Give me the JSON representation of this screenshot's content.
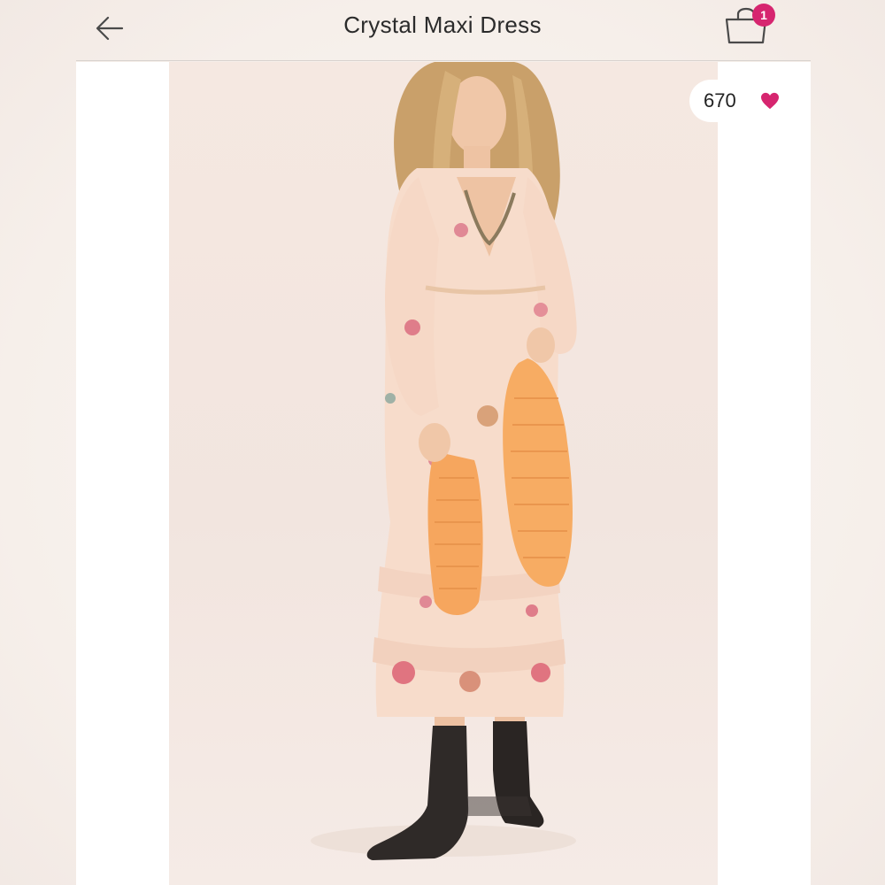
{
  "header": {
    "title": "Crystal Maxi Dress",
    "back_icon": "arrow-left-icon",
    "bag_icon": "shopping-bag-icon",
    "bag_count": "1"
  },
  "listing": {
    "likes_count": "670",
    "like_icon": "heart-icon",
    "photo_description_icon": "product-photo"
  },
  "colors": {
    "accent": "#d6256f",
    "text": "#2b2b2b",
    "background": "#f7f1ed"
  }
}
